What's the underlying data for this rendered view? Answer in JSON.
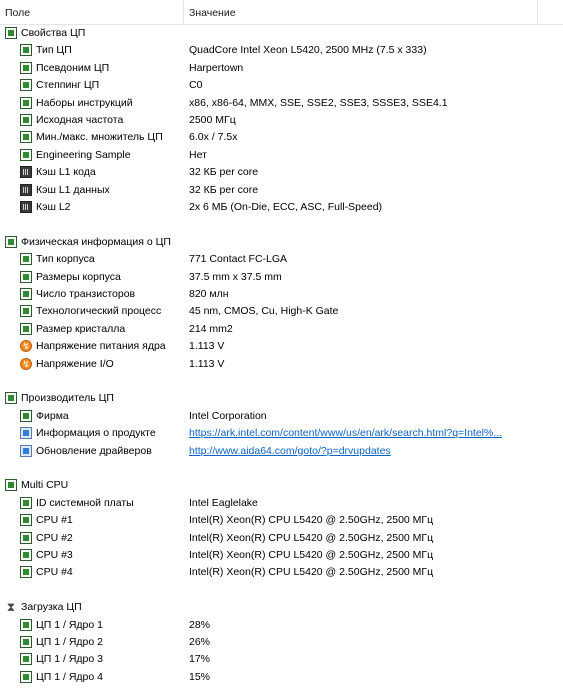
{
  "header": {
    "col_field": "Поле",
    "col_value": "Значение"
  },
  "rows": [
    {
      "type": "section",
      "icon": "cpu-board-icon",
      "label": "Свойства ЦП",
      "value": ""
    },
    {
      "type": "item",
      "icon": "cpu-board-icon",
      "label": "Тип ЦП",
      "value": "QuadCore Intel Xeon L5420, 2500 MHz (7.5 x 333)"
    },
    {
      "type": "item",
      "icon": "cpu-board-icon",
      "label": "Псевдоним ЦП",
      "value": "Harpertown"
    },
    {
      "type": "item",
      "icon": "cpu-board-icon",
      "label": "Степпинг ЦП",
      "value": "C0"
    },
    {
      "type": "item",
      "icon": "cpu-board-icon",
      "label": "Наборы инструкций",
      "value": "x86, x86-64, MMX, SSE, SSE2, SSE3, SSSE3, SSE4.1"
    },
    {
      "type": "item",
      "icon": "cpu-board-icon",
      "label": "Исходная частота",
      "value": "2500 МГц"
    },
    {
      "type": "item",
      "icon": "cpu-board-icon",
      "label": "Мин./макс. множитель ЦП",
      "value": "6.0x / 7.5x"
    },
    {
      "type": "item",
      "icon": "cpu-board-icon",
      "label": "Engineering Sample",
      "value": "Нет"
    },
    {
      "type": "item",
      "icon": "memory-chip-icon",
      "label": "Кэш L1 кода",
      "value": "32 КБ per core"
    },
    {
      "type": "item",
      "icon": "memory-chip-icon",
      "label": "Кэш L1 данных",
      "value": "32 КБ per core"
    },
    {
      "type": "item",
      "icon": "memory-chip-icon",
      "label": "Кэш L2",
      "value": "2x 6 МБ  (On-Die, ECC, ASC, Full-Speed)"
    },
    {
      "type": "spacer"
    },
    {
      "type": "section",
      "icon": "cpu-board-icon",
      "label": "Физическая информация о ЦП",
      "value": ""
    },
    {
      "type": "item",
      "icon": "cpu-board-icon",
      "label": "Тип корпуса",
      "value": "771 Contact FC-LGA"
    },
    {
      "type": "item",
      "icon": "cpu-board-icon",
      "label": "Размеры корпуса",
      "value": "37.5 mm x 37.5 mm"
    },
    {
      "type": "item",
      "icon": "cpu-board-icon",
      "label": "Число транзисторов",
      "value": "820 млн"
    },
    {
      "type": "item",
      "icon": "cpu-board-icon",
      "label": "Технологический процесс",
      "value": "45 nm, CMOS, Cu, High-K Gate"
    },
    {
      "type": "item",
      "icon": "cpu-board-icon",
      "label": "Размер кристалла",
      "value": "214 mm2"
    },
    {
      "type": "item",
      "icon": "voltage-bolt-icon",
      "label": "Напряжение питания ядра",
      "value": "1.113 V"
    },
    {
      "type": "item",
      "icon": "voltage-bolt-icon",
      "label": "Напряжение I/O",
      "value": "1.113 V"
    },
    {
      "type": "spacer"
    },
    {
      "type": "section",
      "icon": "cpu-board-icon",
      "label": "Производитель ЦП",
      "value": ""
    },
    {
      "type": "item",
      "icon": "cpu-board-icon",
      "label": "Фирма",
      "value": "Intel Corporation"
    },
    {
      "type": "item",
      "icon": "web-link-icon",
      "label": "Информация о продукте",
      "value": "https://ark.intel.com/content/www/us/en/ark/search.html?q=Intel%...",
      "link": true
    },
    {
      "type": "item",
      "icon": "web-link-icon",
      "label": "Обновление драйверов",
      "value": "http://www.aida64.com/goto/?p=drvupdates",
      "link": true
    },
    {
      "type": "spacer"
    },
    {
      "type": "section",
      "icon": "cpu-board-icon",
      "label": "Multi CPU",
      "value": ""
    },
    {
      "type": "item",
      "icon": "cpu-board-icon",
      "label": "ID системной платы",
      "value": "Intel Eaglelake"
    },
    {
      "type": "item",
      "icon": "cpu-board-icon",
      "label": "CPU #1",
      "value": "Intel(R) Xeon(R) CPU L5420 @ 2.50GHz, 2500 МГц"
    },
    {
      "type": "item",
      "icon": "cpu-board-icon",
      "label": "CPU #2",
      "value": "Intel(R) Xeon(R) CPU L5420 @ 2.50GHz, 2500 МГц"
    },
    {
      "type": "item",
      "icon": "cpu-board-icon",
      "label": "CPU #3",
      "value": "Intel(R) Xeon(R) CPU L5420 @ 2.50GHz, 2500 МГц"
    },
    {
      "type": "item",
      "icon": "cpu-board-icon",
      "label": "CPU #4",
      "value": "Intel(R) Xeon(R) CPU L5420 @ 2.50GHz, 2500 МГц"
    },
    {
      "type": "spacer"
    },
    {
      "type": "section",
      "icon": "hourglass-icon",
      "label": "Загрузка ЦП",
      "value": ""
    },
    {
      "type": "item",
      "icon": "cpu-board-icon",
      "label": "ЦП 1 / Ядро 1",
      "value": "28%"
    },
    {
      "type": "item",
      "icon": "cpu-board-icon",
      "label": "ЦП 1 / Ядро 2",
      "value": "26%"
    },
    {
      "type": "item",
      "icon": "cpu-board-icon",
      "label": "ЦП 1 / Ядро 3",
      "value": "17%"
    },
    {
      "type": "item",
      "icon": "cpu-board-icon",
      "label": "ЦП 1 / Ядро 4",
      "value": "15%"
    }
  ]
}
